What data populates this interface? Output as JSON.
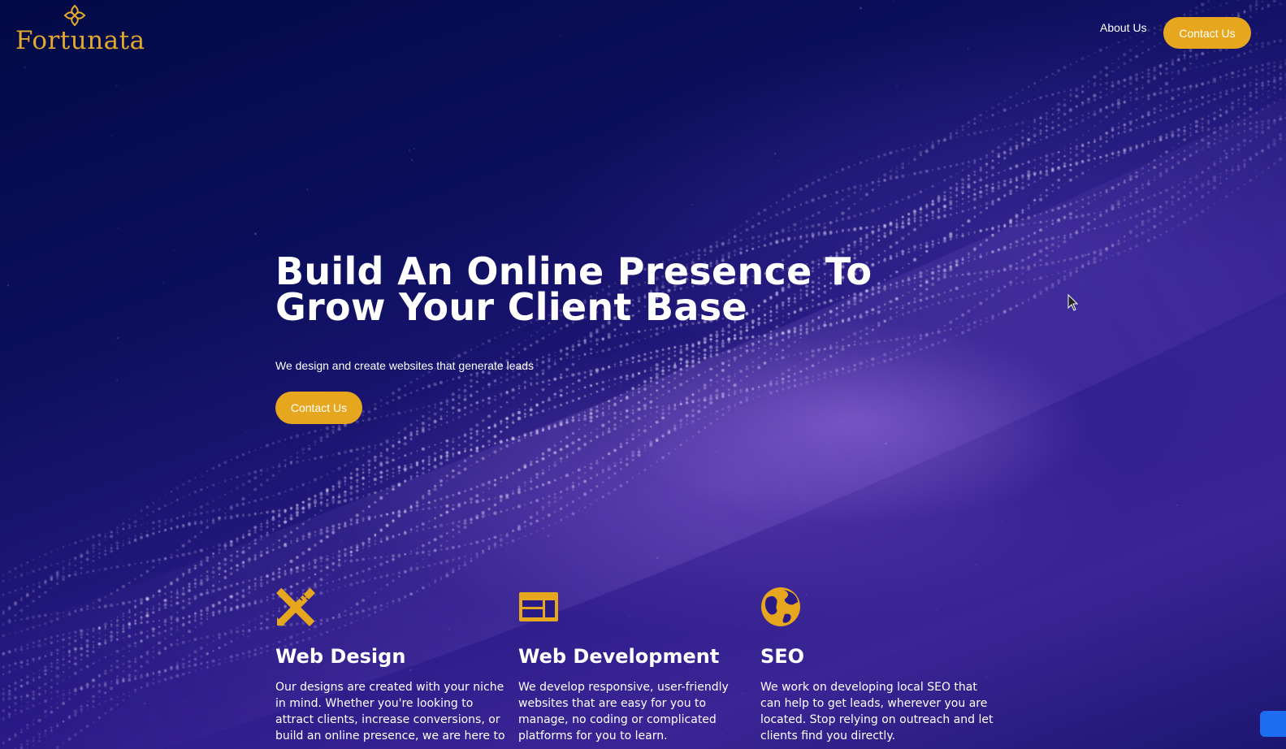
{
  "brand": {
    "name": "Fortunata",
    "color": "#e6a71e"
  },
  "nav": {
    "about_label": "About Us",
    "contact_label": "Contact Us"
  },
  "hero": {
    "headline_line1": "Build An Online Presence To",
    "headline_line2": "Grow Your Client Base",
    "subtitle": "We design and create websites that generate leads",
    "cta_label": "Contact Us"
  },
  "features": [
    {
      "icon": "pencil-ruler-icon",
      "title": "Web Design",
      "text": "Our designs are created with your niche in mind. Whether you're looking to attract clients, increase conversions, or build an online presence, we are here to"
    },
    {
      "icon": "browser-window-icon",
      "title": "Web Development",
      "text": "We develop responsive, user-friendly websites that are easy for you to manage, no coding or complicated platforms for you to learn."
    },
    {
      "icon": "globe-icon",
      "title": "SEO",
      "text": "We work on developing local SEO that can help to get leads, wherever you are located. Stop relying on outreach and let clients find you directly."
    }
  ]
}
